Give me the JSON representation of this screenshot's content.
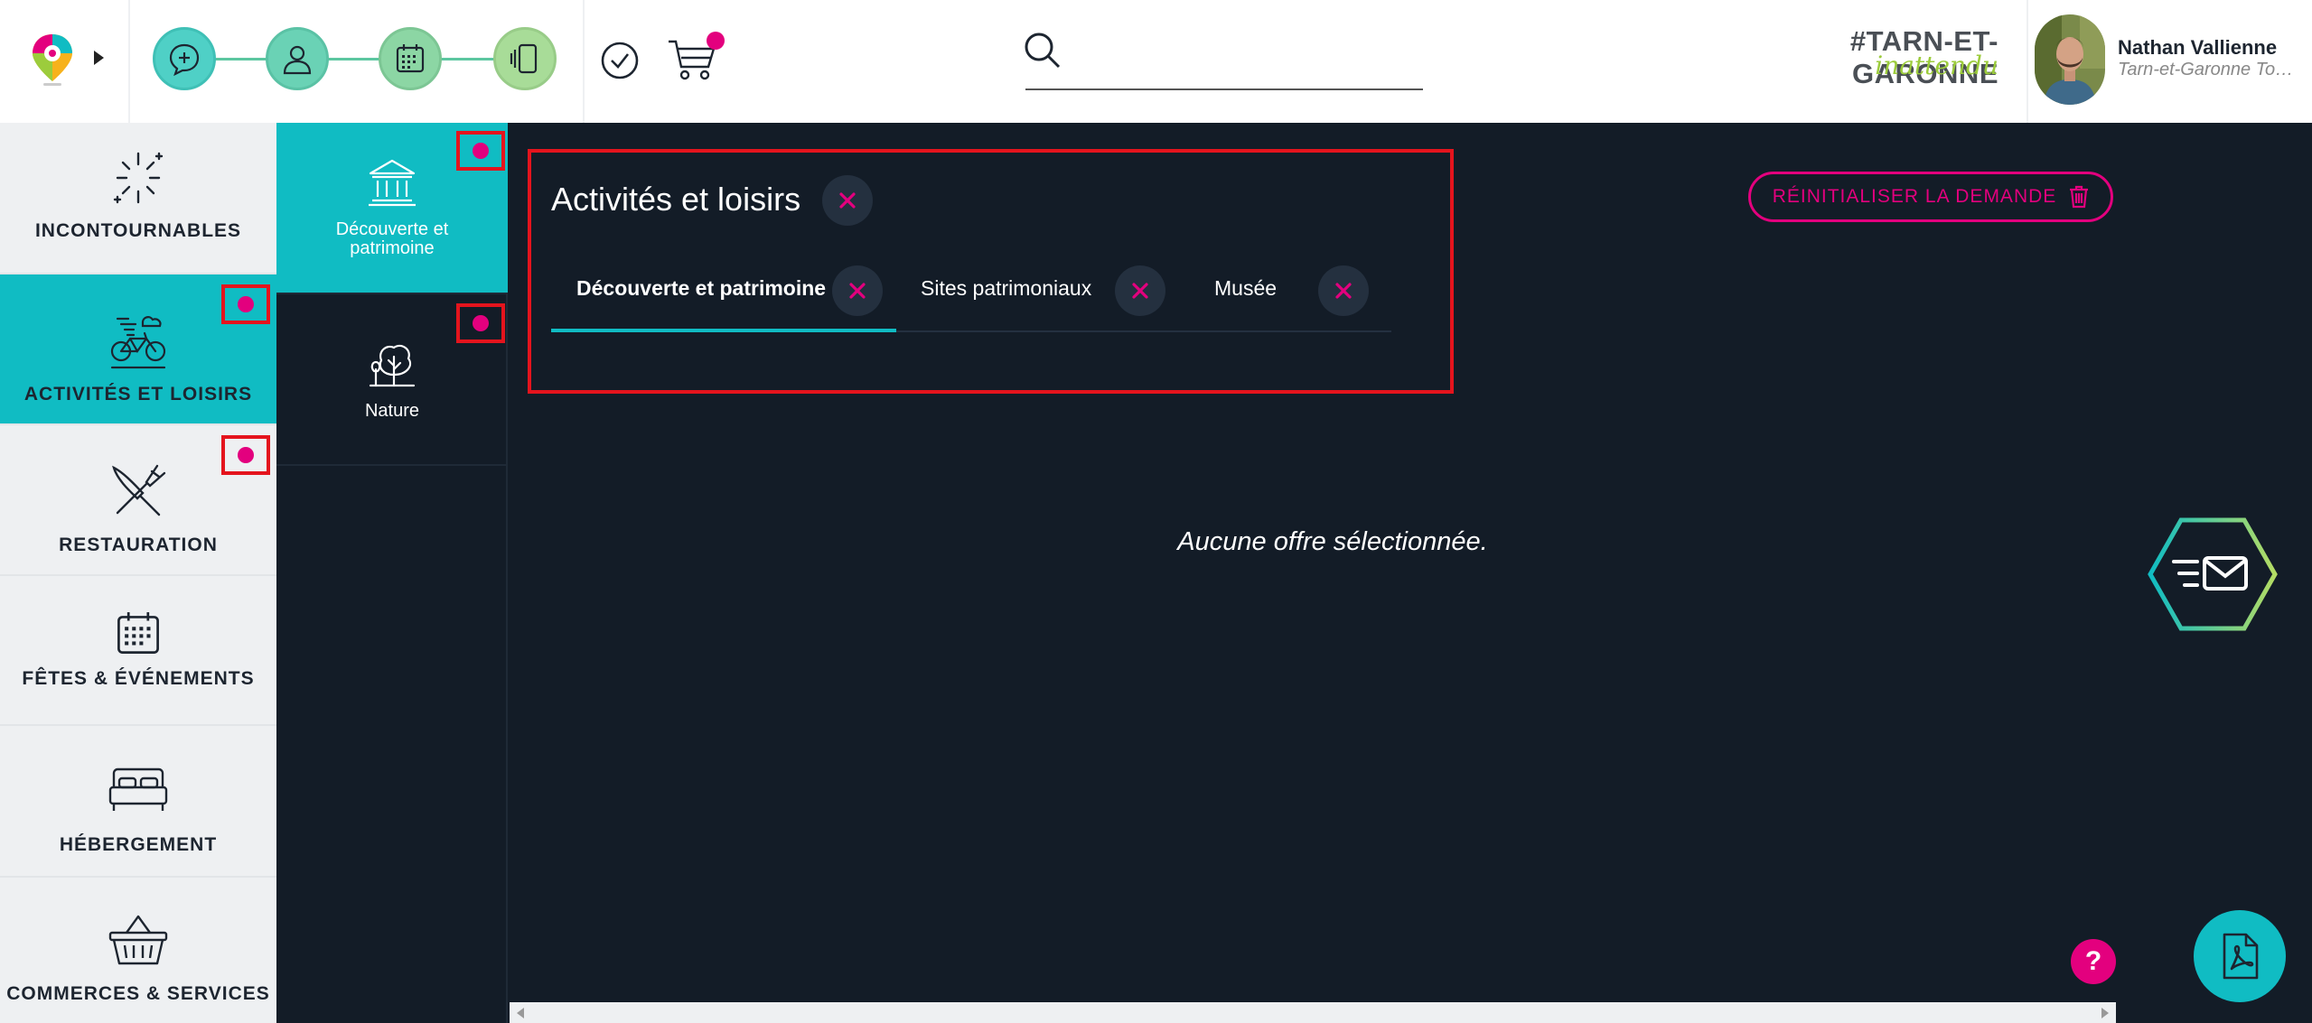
{
  "header": {
    "brand_line1": "#TARN-ET-GARONNE",
    "brand_line2": "inattendu",
    "search": {
      "value": "",
      "placeholder": ""
    },
    "user": {
      "name": "Nathan Vallienne",
      "organization": "Tarn-et-Garonne Tourisme"
    },
    "steps": [
      {
        "icon": "chat-plus-icon",
        "color": "#4fd0c6"
      },
      {
        "icon": "user-icon",
        "color": "#6ad2b5"
      },
      {
        "icon": "calendar-icon",
        "color": "#8cd6a4"
      },
      {
        "icon": "mobile-swipe-icon",
        "color": "#a8dc98"
      }
    ]
  },
  "sidebar": {
    "items": [
      {
        "label": "INCONTOURNABLES",
        "icon": "sparkle-icon",
        "active": false,
        "marker": false
      },
      {
        "label": "ACTIVITÉS ET LOISIRS",
        "icon": "bike-icon",
        "active": true,
        "marker": true
      },
      {
        "label": "RESTAURATION",
        "icon": "fork-knife-icon",
        "active": false,
        "marker": true
      },
      {
        "label": "FÊTES & ÉVÉNEMENTS",
        "icon": "calendar-icon",
        "active": false,
        "marker": false
      },
      {
        "label": "HÉBERGEMENT",
        "icon": "bed-icon",
        "active": false,
        "marker": false
      },
      {
        "label": "COMMERCES & SERVICES",
        "icon": "basket-icon",
        "active": false,
        "marker": false
      }
    ]
  },
  "subcategories": {
    "items": [
      {
        "label": "Découverte et patrimoine",
        "icon": "monument-icon",
        "active": true
      },
      {
        "label": "Nature",
        "icon": "tree-icon",
        "active": false
      }
    ]
  },
  "selection": {
    "title": "Activités et loisirs",
    "tabs": [
      {
        "label": "Découverte et patrimoine",
        "active": true
      },
      {
        "label": "Sites patrimoniaux",
        "active": false
      },
      {
        "label": "Musée",
        "active": false
      }
    ]
  },
  "main": {
    "reset_label": "RÉINITIALISER LA DEMANDE",
    "empty_message": "Aucune offre sélectionnée.",
    "help_label": "?"
  },
  "colors": {
    "accent": "#10bcc3",
    "pink": "#e3007e",
    "marker": "#e4141d",
    "dark": "#131c27"
  }
}
